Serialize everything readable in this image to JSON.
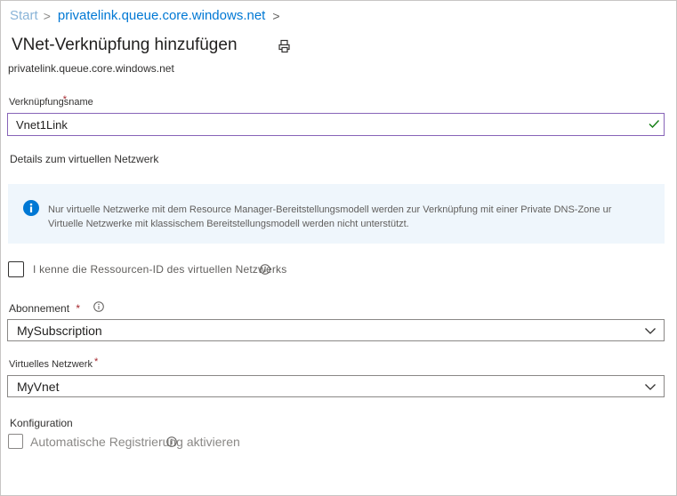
{
  "breadcrumb": {
    "home": "Start",
    "separator": ">",
    "current": "privatelink.queue.core.windows.net",
    "chevron": ">"
  },
  "header": {
    "title": "VNet-Verknüpfung hinzufügen",
    "subtitle": "privatelink.queue.core.windows.net",
    "print_icon": "print-icon"
  },
  "link_name": {
    "label": "Verknüpfungsname",
    "required_marker": "*",
    "value": "Vnet1Link",
    "valid_icon": "checkmark-icon"
  },
  "vnet_details": {
    "heading": "Details zum virtuellen Netzwerk"
  },
  "info_box": {
    "icon": "info-icon",
    "line1": "Nur virtuelle Netzwerke mit dem Resource Manager-Bereitstellungsmodell werden zur Verknüpfung mit einer Private DNS-Zone ur",
    "line2": "Virtuelle Netzwerke mit klassischem Bereitstellungsmodell werden nicht unterstützt."
  },
  "resource_id_checkbox": {
    "label": "I kenne die Ressourcen-ID des virtuellen Netzwerks",
    "checked": false
  },
  "subscription": {
    "label": "Abonnement",
    "required_marker": "*",
    "value": "MySubscription"
  },
  "virtual_network": {
    "label": "Virtuelles Netzwerk",
    "required_marker": "*",
    "value": "MyVnet"
  },
  "configuration": {
    "heading": "Konfiguration",
    "auto_registration_label": "Automatische Registrierung aktivieren",
    "checked": false
  },
  "colors": {
    "link": "#0078d4",
    "focus_border": "#8764b8",
    "required": "#a4262c",
    "info_bg": "#eff6fc",
    "info_icon": "#0078d4",
    "valid_check": "#107c10"
  }
}
